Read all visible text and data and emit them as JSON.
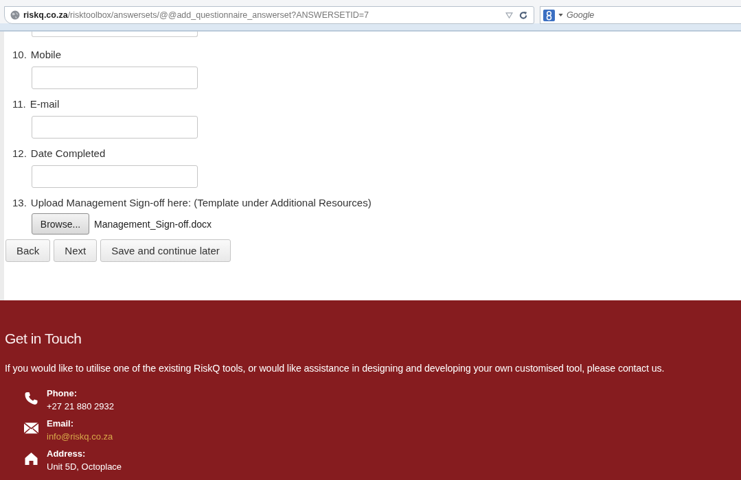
{
  "browser": {
    "address": "**riskq.co.za**/risktoolbox/answersets/@@add_questionnaire_answerset?ANSWERSETID=7",
    "search_placeholder": "Google"
  },
  "form": {
    "questions": [
      {
        "number": "10.",
        "label": "Mobile",
        "kind": "text"
      },
      {
        "number": "11.",
        "label": "E-mail",
        "kind": "text"
      },
      {
        "number": "12.",
        "label": "Date Completed",
        "kind": "text"
      },
      {
        "number": "13.",
        "label": "Upload Management Sign-off here: (Template under Additional Resources)",
        "kind": "file",
        "button": "Browse...",
        "file_name": "Management_Sign-off.docx"
      }
    ],
    "buttons": [
      "Back",
      "Next",
      "Save and continue later"
    ]
  },
  "footer": {
    "title": "Get in Touch",
    "intro": "If you would like to utilise one of the existing RiskQ tools, or would like assistance in designing and developing your own customised tool, please contact us.",
    "contacts": [
      {
        "kind": "phone",
        "label": "Phone:",
        "value": "+27 21 880 2932"
      },
      {
        "kind": "email",
        "label": "Email:",
        "value": "info@riskq.co.za"
      },
      {
        "kind": "address",
        "label": "Address:",
        "value": "Unit 5D, Octoplace"
      }
    ]
  }
}
